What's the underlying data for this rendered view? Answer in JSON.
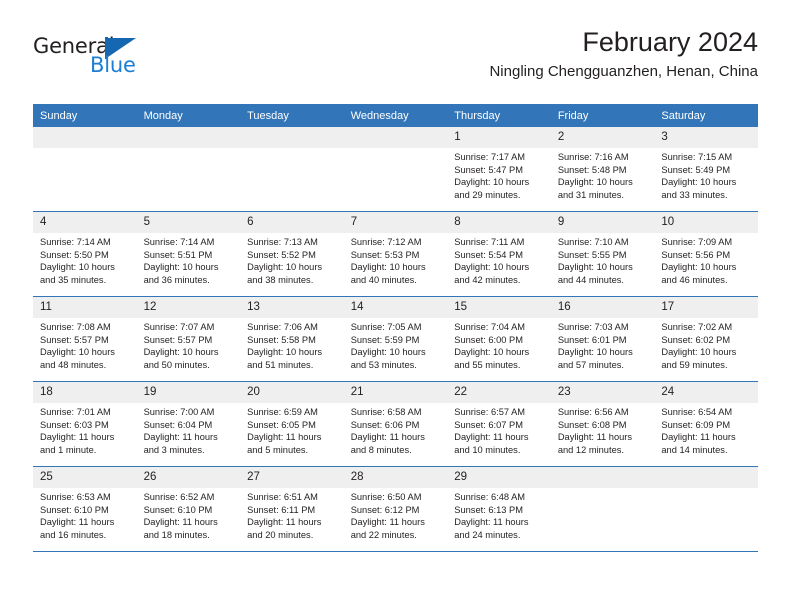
{
  "brand": {
    "name_top": "General",
    "name_bottom": "Blue",
    "mark": "triangle-flag-icon"
  },
  "header": {
    "title": "February 2024",
    "subtitle": "Ningling Chengguanzhen, Henan, China"
  },
  "colors": {
    "header_blue": "#3275b8",
    "daynum_band": "#efefef",
    "brand_blue": "#1c7fd4",
    "text": "#231f20"
  },
  "calendar": {
    "weekdays": [
      "Sunday",
      "Monday",
      "Tuesday",
      "Wednesday",
      "Thursday",
      "Friday",
      "Saturday"
    ],
    "weeks": [
      [
        {
          "day": "",
          "sunrise": "",
          "sunset": "",
          "daylight1": "",
          "daylight2": ""
        },
        {
          "day": "",
          "sunrise": "",
          "sunset": "",
          "daylight1": "",
          "daylight2": ""
        },
        {
          "day": "",
          "sunrise": "",
          "sunset": "",
          "daylight1": "",
          "daylight2": ""
        },
        {
          "day": "",
          "sunrise": "",
          "sunset": "",
          "daylight1": "",
          "daylight2": ""
        },
        {
          "day": "1",
          "sunrise": "Sunrise: 7:17 AM",
          "sunset": "Sunset: 5:47 PM",
          "daylight1": "Daylight: 10 hours",
          "daylight2": "and 29 minutes."
        },
        {
          "day": "2",
          "sunrise": "Sunrise: 7:16 AM",
          "sunset": "Sunset: 5:48 PM",
          "daylight1": "Daylight: 10 hours",
          "daylight2": "and 31 minutes."
        },
        {
          "day": "3",
          "sunrise": "Sunrise: 7:15 AM",
          "sunset": "Sunset: 5:49 PM",
          "daylight1": "Daylight: 10 hours",
          "daylight2": "and 33 minutes."
        }
      ],
      [
        {
          "day": "4",
          "sunrise": "Sunrise: 7:14 AM",
          "sunset": "Sunset: 5:50 PM",
          "daylight1": "Daylight: 10 hours",
          "daylight2": "and 35 minutes."
        },
        {
          "day": "5",
          "sunrise": "Sunrise: 7:14 AM",
          "sunset": "Sunset: 5:51 PM",
          "daylight1": "Daylight: 10 hours",
          "daylight2": "and 36 minutes."
        },
        {
          "day": "6",
          "sunrise": "Sunrise: 7:13 AM",
          "sunset": "Sunset: 5:52 PM",
          "daylight1": "Daylight: 10 hours",
          "daylight2": "and 38 minutes."
        },
        {
          "day": "7",
          "sunrise": "Sunrise: 7:12 AM",
          "sunset": "Sunset: 5:53 PM",
          "daylight1": "Daylight: 10 hours",
          "daylight2": "and 40 minutes."
        },
        {
          "day": "8",
          "sunrise": "Sunrise: 7:11 AM",
          "sunset": "Sunset: 5:54 PM",
          "daylight1": "Daylight: 10 hours",
          "daylight2": "and 42 minutes."
        },
        {
          "day": "9",
          "sunrise": "Sunrise: 7:10 AM",
          "sunset": "Sunset: 5:55 PM",
          "daylight1": "Daylight: 10 hours",
          "daylight2": "and 44 minutes."
        },
        {
          "day": "10",
          "sunrise": "Sunrise: 7:09 AM",
          "sunset": "Sunset: 5:56 PM",
          "daylight1": "Daylight: 10 hours",
          "daylight2": "and 46 minutes."
        }
      ],
      [
        {
          "day": "11",
          "sunrise": "Sunrise: 7:08 AM",
          "sunset": "Sunset: 5:57 PM",
          "daylight1": "Daylight: 10 hours",
          "daylight2": "and 48 minutes."
        },
        {
          "day": "12",
          "sunrise": "Sunrise: 7:07 AM",
          "sunset": "Sunset: 5:57 PM",
          "daylight1": "Daylight: 10 hours",
          "daylight2": "and 50 minutes."
        },
        {
          "day": "13",
          "sunrise": "Sunrise: 7:06 AM",
          "sunset": "Sunset: 5:58 PM",
          "daylight1": "Daylight: 10 hours",
          "daylight2": "and 51 minutes."
        },
        {
          "day": "14",
          "sunrise": "Sunrise: 7:05 AM",
          "sunset": "Sunset: 5:59 PM",
          "daylight1": "Daylight: 10 hours",
          "daylight2": "and 53 minutes."
        },
        {
          "day": "15",
          "sunrise": "Sunrise: 7:04 AM",
          "sunset": "Sunset: 6:00 PM",
          "daylight1": "Daylight: 10 hours",
          "daylight2": "and 55 minutes."
        },
        {
          "day": "16",
          "sunrise": "Sunrise: 7:03 AM",
          "sunset": "Sunset: 6:01 PM",
          "daylight1": "Daylight: 10 hours",
          "daylight2": "and 57 minutes."
        },
        {
          "day": "17",
          "sunrise": "Sunrise: 7:02 AM",
          "sunset": "Sunset: 6:02 PM",
          "daylight1": "Daylight: 10 hours",
          "daylight2": "and 59 minutes."
        }
      ],
      [
        {
          "day": "18",
          "sunrise": "Sunrise: 7:01 AM",
          "sunset": "Sunset: 6:03 PM",
          "daylight1": "Daylight: 11 hours",
          "daylight2": "and 1 minute."
        },
        {
          "day": "19",
          "sunrise": "Sunrise: 7:00 AM",
          "sunset": "Sunset: 6:04 PM",
          "daylight1": "Daylight: 11 hours",
          "daylight2": "and 3 minutes."
        },
        {
          "day": "20",
          "sunrise": "Sunrise: 6:59 AM",
          "sunset": "Sunset: 6:05 PM",
          "daylight1": "Daylight: 11 hours",
          "daylight2": "and 5 minutes."
        },
        {
          "day": "21",
          "sunrise": "Sunrise: 6:58 AM",
          "sunset": "Sunset: 6:06 PM",
          "daylight1": "Daylight: 11 hours",
          "daylight2": "and 8 minutes."
        },
        {
          "day": "22",
          "sunrise": "Sunrise: 6:57 AM",
          "sunset": "Sunset: 6:07 PM",
          "daylight1": "Daylight: 11 hours",
          "daylight2": "and 10 minutes."
        },
        {
          "day": "23",
          "sunrise": "Sunrise: 6:56 AM",
          "sunset": "Sunset: 6:08 PM",
          "daylight1": "Daylight: 11 hours",
          "daylight2": "and 12 minutes."
        },
        {
          "day": "24",
          "sunrise": "Sunrise: 6:54 AM",
          "sunset": "Sunset: 6:09 PM",
          "daylight1": "Daylight: 11 hours",
          "daylight2": "and 14 minutes."
        }
      ],
      [
        {
          "day": "25",
          "sunrise": "Sunrise: 6:53 AM",
          "sunset": "Sunset: 6:10 PM",
          "daylight1": "Daylight: 11 hours",
          "daylight2": "and 16 minutes."
        },
        {
          "day": "26",
          "sunrise": "Sunrise: 6:52 AM",
          "sunset": "Sunset: 6:10 PM",
          "daylight1": "Daylight: 11 hours",
          "daylight2": "and 18 minutes."
        },
        {
          "day": "27",
          "sunrise": "Sunrise: 6:51 AM",
          "sunset": "Sunset: 6:11 PM",
          "daylight1": "Daylight: 11 hours",
          "daylight2": "and 20 minutes."
        },
        {
          "day": "28",
          "sunrise": "Sunrise: 6:50 AM",
          "sunset": "Sunset: 6:12 PM",
          "daylight1": "Daylight: 11 hours",
          "daylight2": "and 22 minutes."
        },
        {
          "day": "29",
          "sunrise": "Sunrise: 6:48 AM",
          "sunset": "Sunset: 6:13 PM",
          "daylight1": "Daylight: 11 hours",
          "daylight2": "and 24 minutes."
        },
        {
          "day": "",
          "sunrise": "",
          "sunset": "",
          "daylight1": "",
          "daylight2": ""
        },
        {
          "day": "",
          "sunrise": "",
          "sunset": "",
          "daylight1": "",
          "daylight2": ""
        }
      ]
    ]
  }
}
